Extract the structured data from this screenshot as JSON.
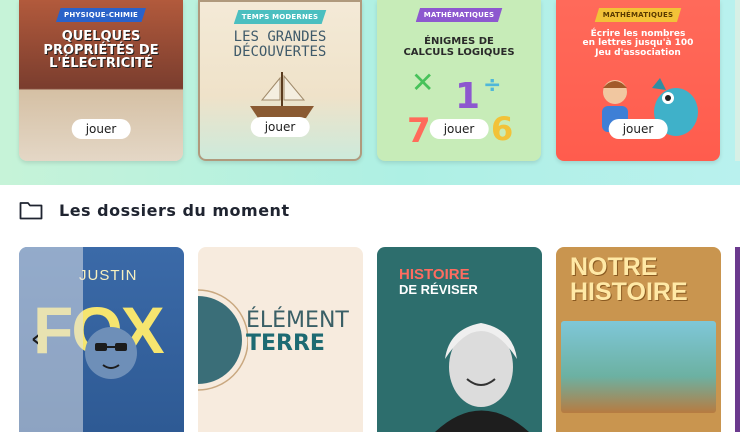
{
  "games": [
    {
      "tag": "PHYSIQUE-CHIMIE",
      "title_lines": [
        "QUELQUES",
        "PROPRIÉTÉS DE",
        "L'ÉLECTRICITÉ"
      ],
      "play_label": "jouer"
    },
    {
      "tag": "TEMPS MODERNES",
      "title_lines": [
        "LES GRANDES",
        "DÉCOUVERTES"
      ],
      "play_label": "jouer"
    },
    {
      "tag": "MATHÉMATIQUES",
      "title_lines": [
        "ÉNIGMES DE",
        "CALCULS LOGIQUES"
      ],
      "play_label": "jouer"
    },
    {
      "tag": "MATHÉMATIQUES",
      "title_lines": [
        "Écrire les nombres",
        "en lettres jusqu'à 100",
        "Jeu d'association"
      ],
      "play_label": "jouer"
    }
  ],
  "section": {
    "title": "Les dossiers du moment",
    "icon": "folder-icon"
  },
  "folders": [
    {
      "title_small": "JUSTIN",
      "title_big": "FOX"
    },
    {
      "title_l1": "ÉLÉMENT",
      "title_l2": "TERRE"
    },
    {
      "title_l1": "HISTOIRE",
      "title_l2": "DE RÉVISER"
    },
    {
      "title_l1": "NOTRE",
      "title_l2": "HISTOIRE"
    }
  ],
  "carousel": {
    "prev_icon": "chevron-left-icon"
  },
  "colors": {
    "band": "#aef0e4",
    "accent_red": "#ff5c4d",
    "text": "#1f2430"
  }
}
